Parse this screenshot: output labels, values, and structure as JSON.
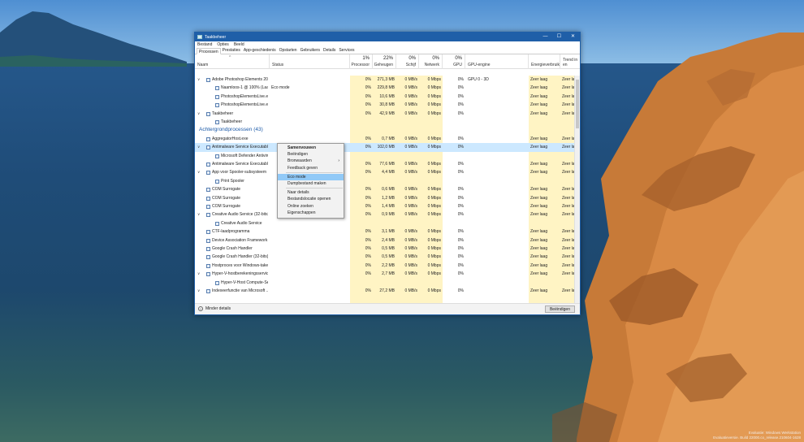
{
  "window": {
    "title": "Taakbeheer",
    "controls": {
      "minimize": "—",
      "maximize": "☐",
      "close": "✕"
    }
  },
  "menu": [
    "Bestand",
    "Opties",
    "Beeld"
  ],
  "tabs": [
    "Processen",
    "Prestaties",
    "App-geschiedenis",
    "Opstarten",
    "Gebruikers",
    "Details",
    "Services"
  ],
  "active_tab": "Processen",
  "columns": {
    "name": "Naam",
    "status": "Status",
    "cpu": {
      "pct": "1%",
      "label": "Processor"
    },
    "mem": {
      "pct": "22%",
      "label": "Geheugen"
    },
    "disk": {
      "pct": "0%",
      "label": "Schijf"
    },
    "net": {
      "pct": "0%",
      "label": "Netwerk"
    },
    "gpu": {
      "pct": "0%",
      "label": "GPU"
    },
    "gpu_engine": "GPU-engine",
    "power": "Energieverbruik",
    "trend": "Trend in en"
  },
  "rows": [
    {
      "type": "proc",
      "indent": 0,
      "expander": "∨",
      "name": "Adobe Photoshop Elements 202...",
      "status": "",
      "cpu": "0%",
      "mem": "271,3 MB",
      "disk": "0 MB/s",
      "net": "0 Mbps",
      "gpu": "0%",
      "gpu_engine": "GPU 0 - 3D",
      "power": "Zeer laag",
      "trend": "Zeer laa"
    },
    {
      "type": "proc",
      "indent": 1,
      "expander": "",
      "name": "Naamloos-1 @ 100% (Laag 1...",
      "status": "Eco mode",
      "cpu": "0%",
      "mem": "229,8 MB",
      "disk": "0 MB/s",
      "net": "0 Mbps",
      "gpu": "0%",
      "gpu_engine": "",
      "power": "Zeer laag",
      "trend": "Zeer laa"
    },
    {
      "type": "proc",
      "indent": 1,
      "expander": "",
      "name": "PhotoshopElementsLive.exe",
      "status": "",
      "cpu": "0%",
      "mem": "10,6 MB",
      "disk": "0 MB/s",
      "net": "0 Mbps",
      "gpu": "0%",
      "gpu_engine": "",
      "power": "Zeer laag",
      "trend": "Zeer laa"
    },
    {
      "type": "proc",
      "indent": 1,
      "expander": "",
      "name": "PhotoshopElementsLive.exe",
      "status": "",
      "cpu": "0%",
      "mem": "30,8 MB",
      "disk": "0 MB/s",
      "net": "0 Mbps",
      "gpu": "0%",
      "gpu_engine": "",
      "power": "Zeer laag",
      "trend": "Zeer laa"
    },
    {
      "type": "proc",
      "indent": 0,
      "expander": "∨",
      "name": "Taakbeheer",
      "status": "",
      "cpu": "0%",
      "mem": "42,9 MB",
      "disk": "0 MB/s",
      "net": "0 Mbps",
      "gpu": "0%",
      "gpu_engine": "",
      "power": "Zeer laag",
      "trend": "Zeer laa"
    },
    {
      "type": "proc",
      "indent": 1,
      "expander": "",
      "name": "Taakbeheer",
      "status": "",
      "cpu": "",
      "mem": "",
      "disk": "",
      "net": "",
      "gpu": "",
      "gpu_engine": "",
      "power": "",
      "trend": ""
    },
    {
      "type": "group",
      "title": "Achtergrondprocessen (43)"
    },
    {
      "type": "proc",
      "indent": 0,
      "expander": "",
      "name": "AggregatorHost.exe",
      "status": "",
      "cpu": "0%",
      "mem": "0,7 MB",
      "disk": "0 MB/s",
      "net": "0 Mbps",
      "gpu": "0%",
      "gpu_engine": "",
      "power": "Zeer laag",
      "trend": "Zeer laa"
    },
    {
      "type": "proc",
      "indent": 0,
      "expander": "∨",
      "name": "Antimalware Service Executable",
      "status": "",
      "cpu": "0%",
      "mem": "102,0 MB",
      "disk": "0 MB/s",
      "net": "0 Mbps",
      "gpu": "0%",
      "gpu_engine": "",
      "power": "Zeer laag",
      "trend": "Zeer laa",
      "selected": true
    },
    {
      "type": "proc",
      "indent": 1,
      "expander": "",
      "name": "Microsoft Defender Antivirus...",
      "status": "",
      "cpu": "",
      "mem": "",
      "disk": "",
      "net": "",
      "gpu": "",
      "gpu_engine": "",
      "power": "",
      "trend": ""
    },
    {
      "type": "proc",
      "indent": 0,
      "expander": "",
      "name": "Antimalware Service Executable...",
      "status": "",
      "cpu": "0%",
      "mem": "77,6 MB",
      "disk": "0 MB/s",
      "net": "0 Mbps",
      "gpu": "0%",
      "gpu_engine": "",
      "power": "Zeer laag",
      "trend": "Zeer laa"
    },
    {
      "type": "proc",
      "indent": 0,
      "expander": "∨",
      "name": "App voor Spooler-subsysteem",
      "status": "",
      "cpu": "0%",
      "mem": "4,4 MB",
      "disk": "0 MB/s",
      "net": "0 Mbps",
      "gpu": "0%",
      "gpu_engine": "",
      "power": "Zeer laag",
      "trend": "Zeer laa"
    },
    {
      "type": "proc",
      "indent": 1,
      "expander": "",
      "name": "Print Spooler",
      "status": "",
      "cpu": "",
      "mem": "",
      "disk": "",
      "net": "",
      "gpu": "",
      "gpu_engine": "",
      "power": "",
      "trend": ""
    },
    {
      "type": "proc",
      "indent": 0,
      "expander": "",
      "name": "COM Surrogate",
      "status": "",
      "cpu": "0%",
      "mem": "0,6 MB",
      "disk": "0 MB/s",
      "net": "0 Mbps",
      "gpu": "0%",
      "gpu_engine": "",
      "power": "Zeer laag",
      "trend": "Zeer laa"
    },
    {
      "type": "proc",
      "indent": 0,
      "expander": "",
      "name": "COM Surrogate",
      "status": "",
      "cpu": "0%",
      "mem": "1,2 MB",
      "disk": "0 MB/s",
      "net": "0 Mbps",
      "gpu": "0%",
      "gpu_engine": "",
      "power": "Zeer laag",
      "trend": "Zeer laa"
    },
    {
      "type": "proc",
      "indent": 0,
      "expander": "",
      "name": "COM Surrogate",
      "status": "",
      "cpu": "0%",
      "mem": "1,4 MB",
      "disk": "0 MB/s",
      "net": "0 Mbps",
      "gpu": "0%",
      "gpu_engine": "",
      "power": "Zeer laag",
      "trend": "Zeer laa"
    },
    {
      "type": "proc",
      "indent": 0,
      "expander": "∨",
      "name": "Creative Audio Service (32-bits)",
      "status": "",
      "cpu": "0%",
      "mem": "0,9 MB",
      "disk": "0 MB/s",
      "net": "0 Mbps",
      "gpu": "0%",
      "gpu_engine": "",
      "power": "Zeer laag",
      "trend": "Zeer laa"
    },
    {
      "type": "proc",
      "indent": 1,
      "expander": "",
      "name": "Creative Audio Service",
      "status": "",
      "cpu": "",
      "mem": "",
      "disk": "",
      "net": "",
      "gpu": "",
      "gpu_engine": "",
      "power": "",
      "trend": ""
    },
    {
      "type": "proc",
      "indent": 0,
      "expander": "",
      "name": "CTF-laadprogramma",
      "status": "",
      "cpu": "0%",
      "mem": "3,1 MB",
      "disk": "0 MB/s",
      "net": "0 Mbps",
      "gpu": "0%",
      "gpu_engine": "",
      "power": "Zeer laag",
      "trend": "Zeer laa"
    },
    {
      "type": "proc",
      "indent": 0,
      "expander": "",
      "name": "Device Association Framework ...",
      "status": "",
      "cpu": "0%",
      "mem": "2,4 MB",
      "disk": "0 MB/s",
      "net": "0 Mbps",
      "gpu": "0%",
      "gpu_engine": "",
      "power": "Zeer laag",
      "trend": "Zeer laa"
    },
    {
      "type": "proc",
      "indent": 0,
      "expander": "",
      "name": "Google Crash Handler",
      "status": "",
      "cpu": "0%",
      "mem": "0,5 MB",
      "disk": "0 MB/s",
      "net": "0 Mbps",
      "gpu": "0%",
      "gpu_engine": "",
      "power": "Zeer laag",
      "trend": "Zeer laa"
    },
    {
      "type": "proc",
      "indent": 0,
      "expander": "",
      "name": "Google Crash Handler (32-bits)",
      "status": "",
      "cpu": "0%",
      "mem": "0,5 MB",
      "disk": "0 MB/s",
      "net": "0 Mbps",
      "gpu": "0%",
      "gpu_engine": "",
      "power": "Zeer laag",
      "trend": "Zeer laa"
    },
    {
      "type": "proc",
      "indent": 0,
      "expander": "",
      "name": "Hostproces voor Windows-taken",
      "status": "",
      "cpu": "0%",
      "mem": "2,2 MB",
      "disk": "0 MB/s",
      "net": "0 Mbps",
      "gpu": "0%",
      "gpu_engine": "",
      "power": "Zeer laag",
      "trend": "Zeer laa"
    },
    {
      "type": "proc",
      "indent": 0,
      "expander": "∨",
      "name": "Hyper-V-hostberekeningsservice",
      "status": "",
      "cpu": "0%",
      "mem": "2,7 MB",
      "disk": "0 MB/s",
      "net": "0 Mbps",
      "gpu": "0%",
      "gpu_engine": "",
      "power": "Zeer laag",
      "trend": "Zeer laa"
    },
    {
      "type": "proc",
      "indent": 1,
      "expander": "",
      "name": "Hyper-V-Host Compute-Ser...",
      "status": "",
      "cpu": "",
      "mem": "",
      "disk": "",
      "net": "",
      "gpu": "",
      "gpu_engine": "",
      "power": "",
      "trend": ""
    },
    {
      "type": "proc",
      "indent": 0,
      "expander": "∨",
      "name": "Indexeerfunctie van Microsoft ...",
      "status": "",
      "cpu": "0%",
      "mem": "27,2 MB",
      "disk": "0 MB/s",
      "net": "0 Mbps",
      "gpu": "0%",
      "gpu_engine": "",
      "power": "Zeer laag",
      "trend": "Zeer laa"
    }
  ],
  "context_menu": [
    {
      "label": "Samenvouwen",
      "bold": true
    },
    {
      "label": "Beëindigen"
    },
    {
      "label": "Bronwaarden",
      "submenu": "›"
    },
    {
      "label": "Feedback geven"
    },
    {
      "sep": true
    },
    {
      "label": "Eco mode",
      "highlighted": true
    },
    {
      "label": "Dumpbestand maken"
    },
    {
      "sep": true
    },
    {
      "label": "Naar details"
    },
    {
      "label": "Bestandslocatie openen"
    },
    {
      "label": "Online zoeken"
    },
    {
      "label": "Eigenschappen"
    }
  ],
  "footer": {
    "fewer_details": "Minder details",
    "end_task": "Beëindigen"
  },
  "watermark": {
    "line1": "Evaluatie: Windows Werkstation",
    "line2": "Evaluatieversie. Build 22000.co_release.210604-1628"
  },
  "colors": {
    "titlebar": "#1f5fa8",
    "heat": "#fff4c4",
    "selection": "#cce8ff",
    "menu_highlight": "#91c9f7",
    "group_title": "#1c5aa8"
  }
}
